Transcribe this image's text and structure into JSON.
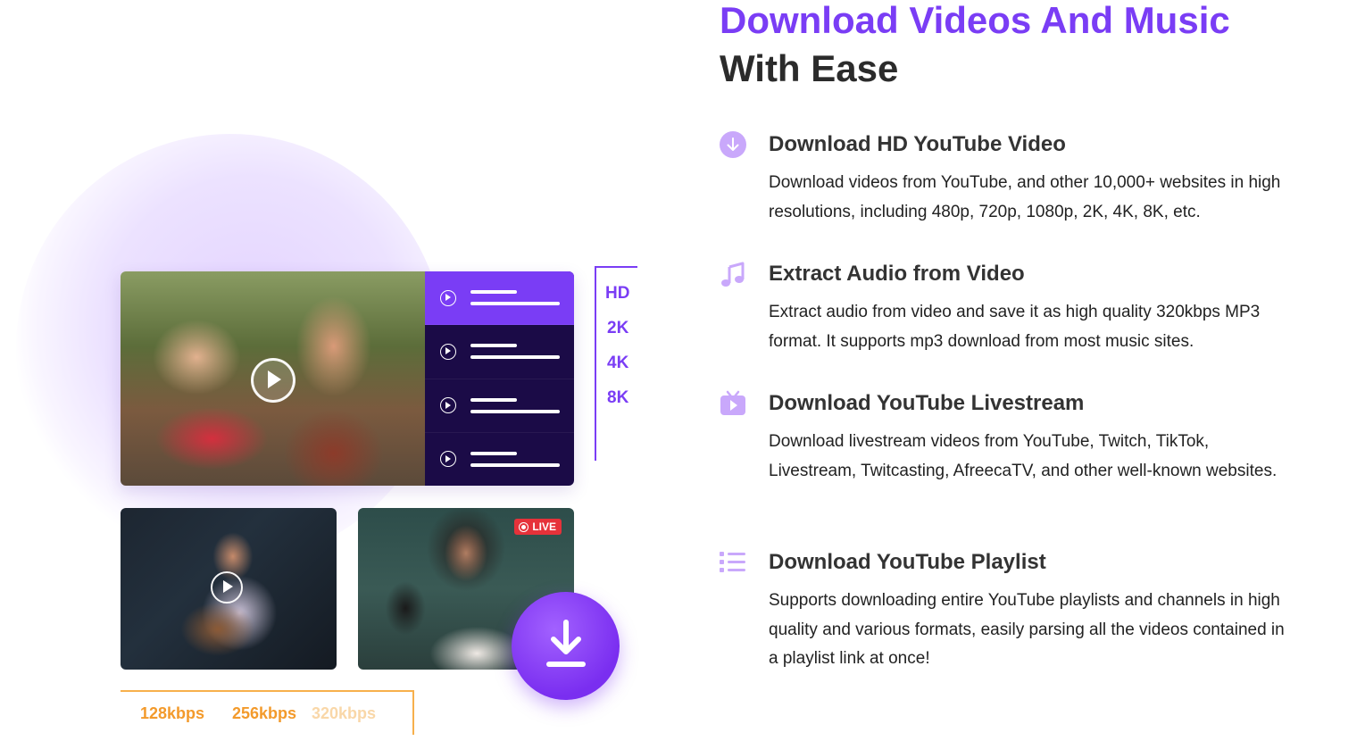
{
  "heading": {
    "line1": "Download Videos And Music",
    "line2": "With Ease"
  },
  "colors": {
    "accent": "#7a3df5",
    "playlist_bg": "#1b0b47",
    "kbps": "#f39a2b",
    "kbps_faded": "#f9d7a8",
    "live_red": "#e6323a"
  },
  "illustration": {
    "resolutions": [
      "HD",
      "2K",
      "4K",
      "8K"
    ],
    "bitrates": [
      "128kbps",
      "256kbps",
      "320kbps"
    ],
    "live_badge": "LIVE",
    "playlist_rows": 4,
    "icons": [
      "play-icon",
      "download-icon",
      "live-record-icon"
    ]
  },
  "features": [
    {
      "icon": "download-arrow-icon",
      "title": "Download HD YouTube Video",
      "description": "Download videos from YouTube, and other 10,000+ websites in high resolutions, including 480p, 720p, 1080p, 2K, 4K, 8K, etc."
    },
    {
      "icon": "music-note-icon",
      "title": "Extract Audio from Video",
      "description": "Extract audio from video and save it as high quality 320kbps MP3 format. It supports mp3 download from most music sites."
    },
    {
      "icon": "tv-play-icon",
      "title": "Download YouTube Livestream",
      "description": "Download livestream videos from YouTube, Twitch, TikTok, Livestream, Twitcasting, AfreecaTV, and other well-known websites."
    },
    {
      "icon": "playlist-icon",
      "title": "Download YouTube Playlist",
      "description": "Supports downloading entire YouTube playlists and channels in high quality and various formats, easily parsing all the videos contained in a playlist link at once!"
    }
  ]
}
